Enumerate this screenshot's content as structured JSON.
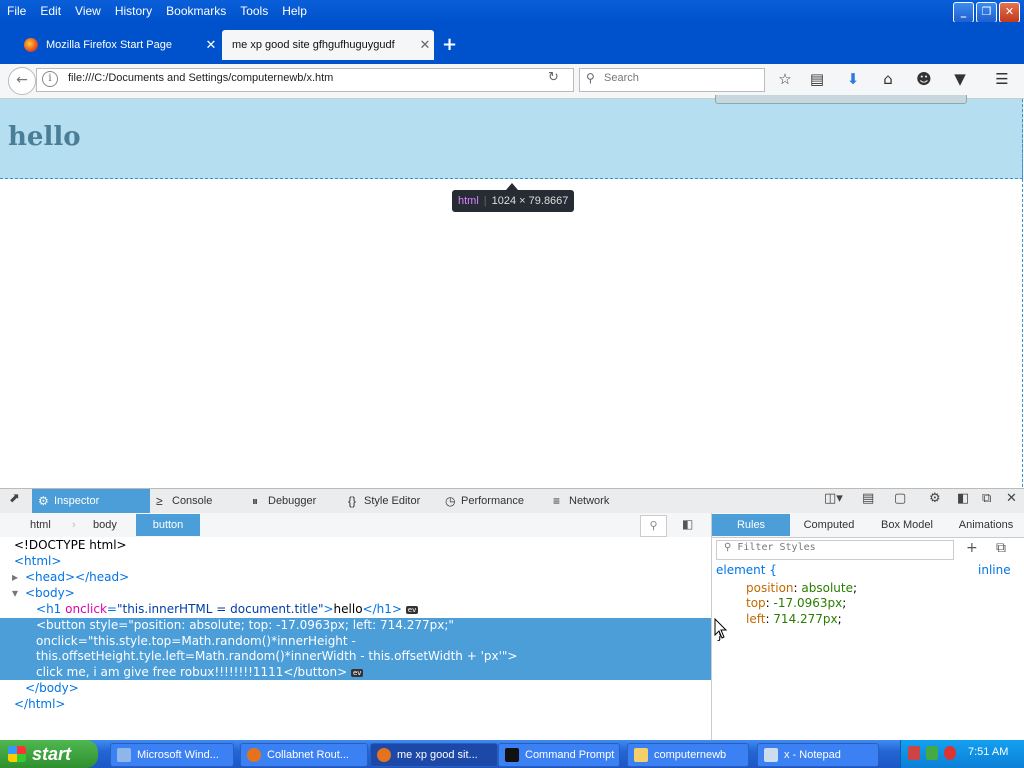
{
  "menu": [
    "File",
    "Edit",
    "View",
    "History",
    "Bookmarks",
    "Tools",
    "Help"
  ],
  "window_buttons": {
    "minimize": "_",
    "restore": "❐",
    "close": "✕"
  },
  "tabs": [
    {
      "label": "Mozilla Firefox Start Page"
    },
    {
      "label": "me xp good site gfhgufhuguygudf"
    }
  ],
  "newtab": "+",
  "url": "file:///C:/Documents and Settings/computernewb/x.htm",
  "search_placeholder": "Search",
  "page": {
    "heading": "hello",
    "tooltip": {
      "tag": "html",
      "dims": "1024 × 79.8667"
    }
  },
  "devtools": {
    "tabs": [
      "Inspector",
      "Console",
      "Debugger",
      "Style Editor",
      "Performance",
      "Network"
    ],
    "breadcrumbs": [
      "html",
      "body",
      "button"
    ],
    "markup": {
      "doctype": "<!DOCTYPE html>",
      "html_open": "<html>",
      "head": "<head></head>",
      "body_open": "<body>",
      "h1_tag": "h1",
      "h1_attr": "onclick",
      "h1_val": "\"this.innerHTML = document.title\"",
      "h1_text": "hello",
      "h1_close": "</h1>",
      "ev": "ev",
      "btn_line1": "<button style=\"position: absolute; top: -17.0963px; left: 714.277px;\"",
      "btn_line2": "onclick=\"this.style.top=Math.random()*innerHeight -",
      "btn_line3": "this.offsetHeight.tyle.left=Math.random()*innerWidth - this.offsetWidth + 'px'\">",
      "btn_line4": "click me, i am give free robux!!!!!!!!1111</button>",
      "body_close": "</body>",
      "html_close": "</html>"
    },
    "rule_tabs": [
      "Rules",
      "Computed",
      "Box Model",
      "Animations"
    ],
    "filter_placeholder": "Filter Styles",
    "rules": {
      "selector": "element {",
      "source": "inline",
      "decls": [
        {
          "prop": "position",
          "val": "absolute"
        },
        {
          "prop": "top",
          "val": "-17.0963px"
        },
        {
          "prop": "left",
          "val": "714.277px"
        }
      ],
      "close": "}"
    }
  },
  "taskbar": {
    "start": "start",
    "items": [
      "Microsoft Wind...",
      "Collabnet Rout...",
      "me xp good sit...",
      "Command Prompt",
      "computernewb",
      "x - Notepad"
    ],
    "clock": "7:51 AM"
  }
}
